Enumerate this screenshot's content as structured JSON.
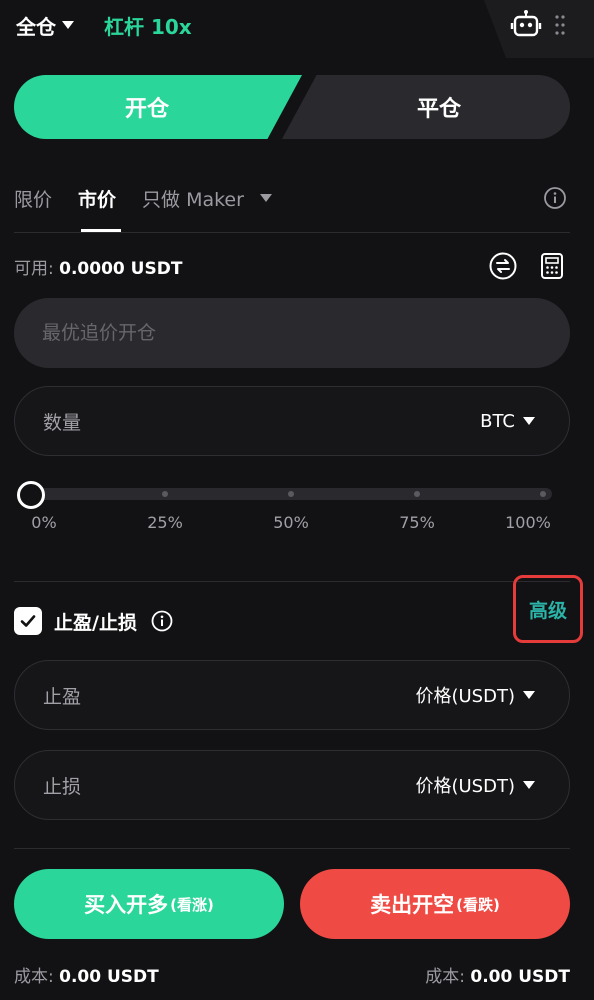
{
  "header": {
    "margin_mode": "全仓",
    "leverage": "杠杆 10x"
  },
  "tabs": {
    "open": "开仓",
    "close": "平仓"
  },
  "order_types": [
    {
      "label": "限价",
      "active": false
    },
    {
      "label": "市价",
      "active": true
    },
    {
      "label": "只做 Maker",
      "active": false
    }
  ],
  "available": {
    "label": "可用:",
    "value": "0.0000 USDT"
  },
  "price_input": {
    "placeholder": "最优追价开仓"
  },
  "quantity": {
    "label": "数量",
    "unit": "BTC"
  },
  "slider": {
    "value_percent": 0,
    "ticks": [
      "0%",
      "25%",
      "50%",
      "75%",
      "100%"
    ]
  },
  "tpsl": {
    "checked": true,
    "label": "止盈/止损",
    "advanced": "高级",
    "take_profit": {
      "label": "止盈",
      "unit": "价格(USDT)"
    },
    "stop_loss": {
      "label": "止损",
      "unit": "价格(USDT)"
    }
  },
  "buttons": {
    "buy_main": "买入开多",
    "buy_sub": "(看涨)",
    "sell_main": "卖出开空",
    "sell_sub": "(看跌)"
  },
  "cost": {
    "label": "成本:",
    "buy_value": "0.00 USDT",
    "sell_value": "0.00 USDT"
  },
  "colors": {
    "accent_green": "#2bd69a",
    "sell_red": "#ef4a43",
    "highlight_box": "#e53b3b",
    "advanced_text": "#2bb3a8"
  }
}
